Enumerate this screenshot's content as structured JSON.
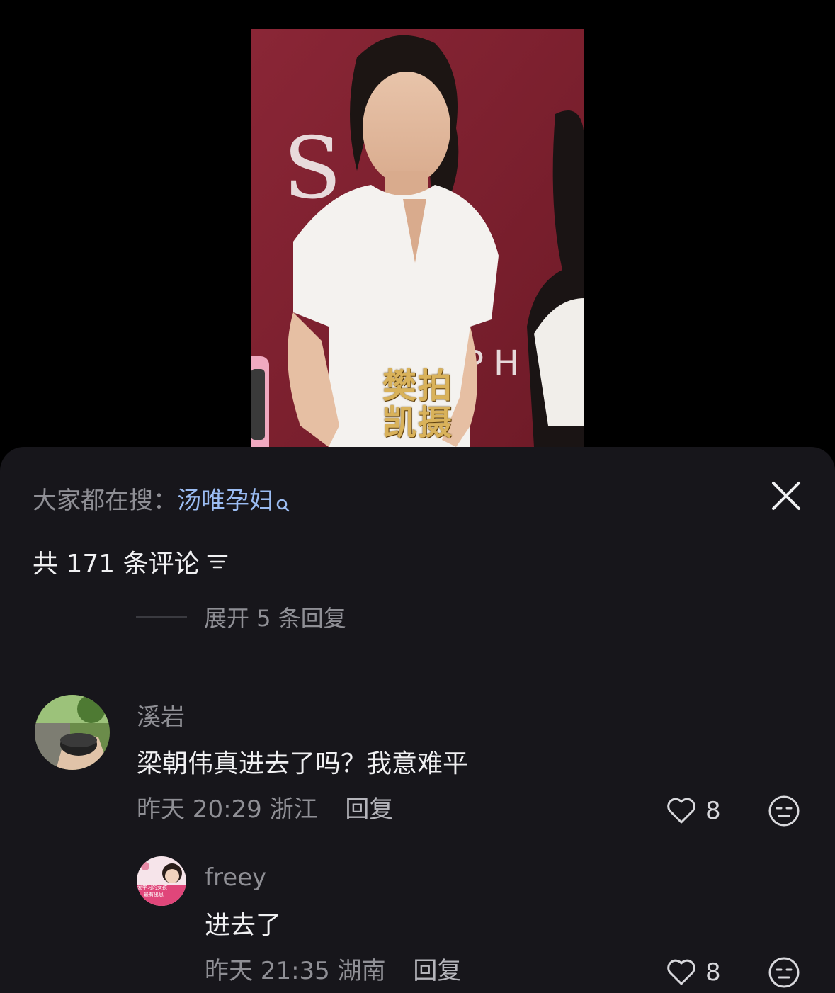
{
  "video": {
    "watermark_line1": "樊拍",
    "watermark_line2": "凯摄",
    "backdrop_text_1": "S",
    "backdrop_text_2": "PH"
  },
  "search": {
    "prefix": "大家都在搜：",
    "term": "汤唯孕妇",
    "icon": "search-icon"
  },
  "close": {
    "icon": "close-icon"
  },
  "comments_header": {
    "label": "共 171 条评论",
    "sort_icon": "sort-icon"
  },
  "expand_replies": {
    "label": "展开 5 条回复"
  },
  "comments": [
    {
      "username": "溪岩",
      "text": "梁朝伟真进去了吗？我意难平",
      "time": "昨天 20:29",
      "location": "浙江",
      "reply_label": "回复",
      "likes": "8"
    },
    {
      "username": "freey",
      "text": "进去了",
      "time": "昨天 21:35",
      "location": "湖南",
      "reply_label": "回复",
      "likes": "8",
      "avatar_text_1": "爱学习的女孩",
      "avatar_text_2": "最有出息"
    }
  ],
  "colors": {
    "sheet_bg": "#17161b",
    "search_term": "#9bbcf2",
    "secondary_text": "#8f8f95",
    "primary_text": "#f0f0f2"
  }
}
